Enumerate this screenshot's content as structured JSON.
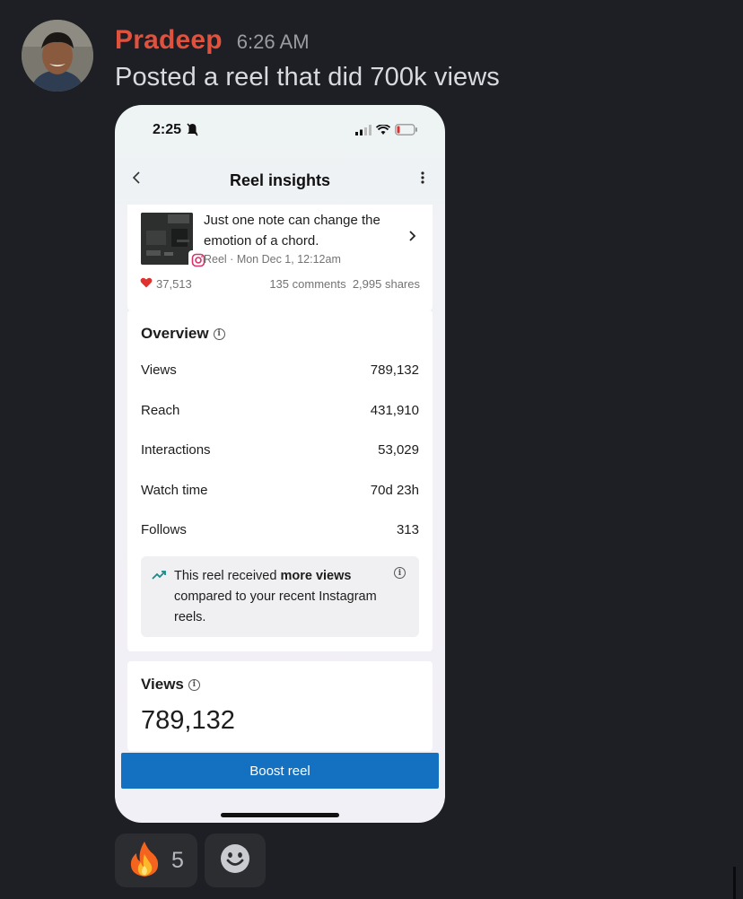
{
  "message": {
    "username": "Pradeep",
    "timestamp": "6:26 AM",
    "text": "Posted a reel that did 700k views"
  },
  "phone": {
    "status_time": "2:25",
    "nav_title": "Reel insights",
    "reel": {
      "title": "Just one note can change the emotion of a chord.",
      "meta": "Reel · Mon Dec 1, 12:12am",
      "likes": "37,513",
      "comments": "135 comments",
      "shares": "2,995 shares"
    },
    "overview": {
      "heading": "Overview",
      "metrics": [
        {
          "label": "Views",
          "value": "789,132"
        },
        {
          "label": "Reach",
          "value": "431,910"
        },
        {
          "label": "Interactions",
          "value": "53,029"
        },
        {
          "label": "Watch time",
          "value": "70d 23h"
        },
        {
          "label": "Follows",
          "value": "313"
        }
      ],
      "callout_prefix": "This reel received ",
      "callout_bold": "more views",
      "callout_suffix": " compared to your recent Instagram reels."
    },
    "views_section": {
      "heading": "Views",
      "value": "789,132"
    },
    "boost_label": "Boost reel"
  },
  "reactions": [
    {
      "emoji": "fire-emoji",
      "count": "5"
    },
    {
      "emoji": "add-reaction-icon"
    }
  ],
  "colors": {
    "background": "#1e1f24",
    "username": "#e0523e",
    "boost_button": "#1470c0",
    "reaction_bg": "#2b2d31",
    "heart": "#e0312e",
    "trend_icon": "#1a8a8a"
  }
}
